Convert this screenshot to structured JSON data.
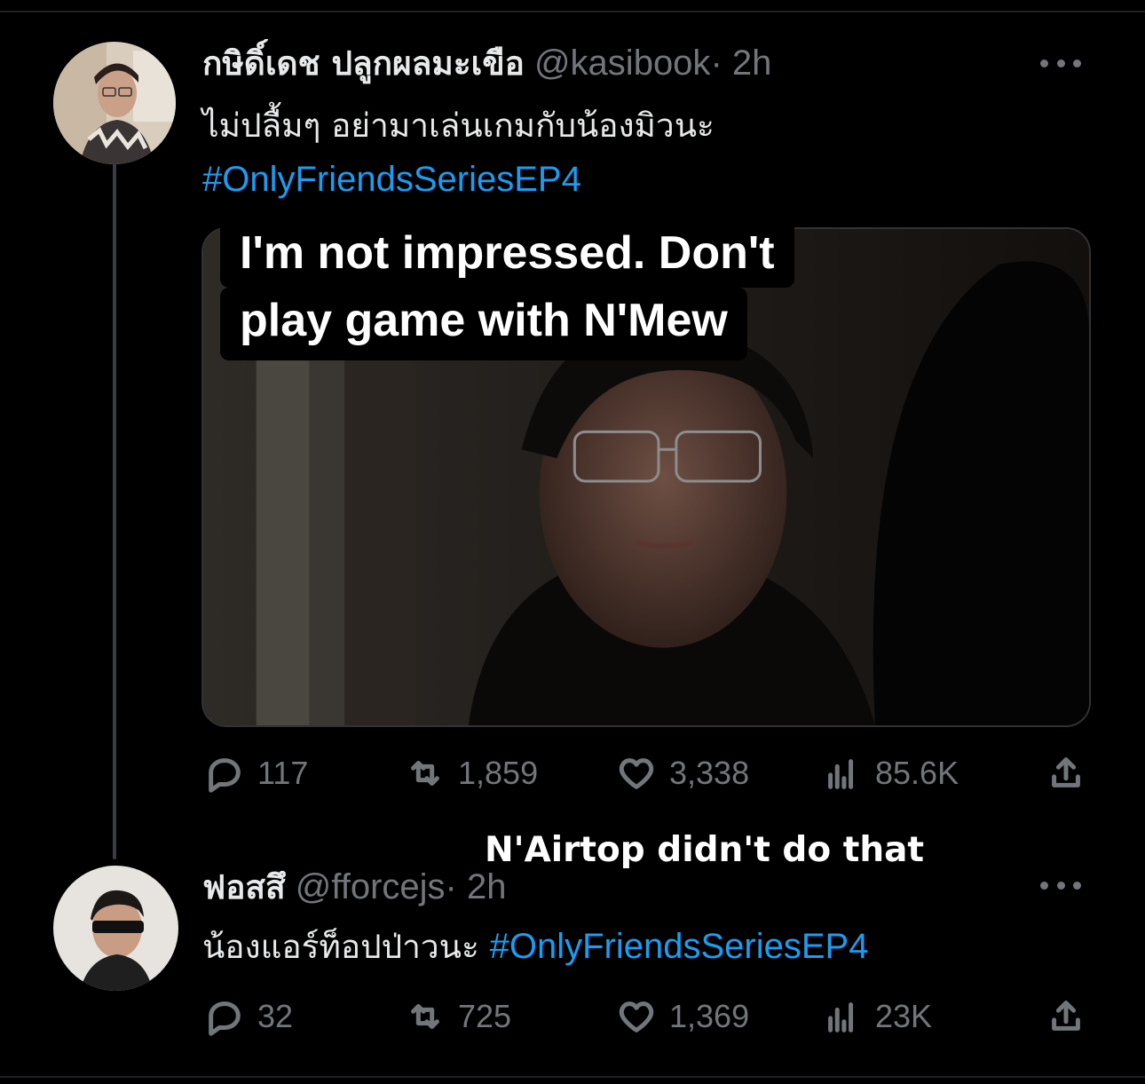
{
  "tweet1": {
    "display_name": "กษิดิ์เดช ปลูกผลมะเขือ",
    "handle": "@kasibook",
    "time": "· 2h",
    "text": "ไม่ปลื้มๆ อย่ามาเล่นเกมกับน้องมิวนะ",
    "hashtag": "#OnlyFriendsSeriesEP4",
    "caption_line1": "I'm not impressed. Don't",
    "caption_line2": "play game with N'Mew",
    "replies": "117",
    "retweets": "1,859",
    "likes": "3,338",
    "views": "85.6K"
  },
  "overlay_caption": "N'Airtop didn't do that",
  "tweet2": {
    "display_name": "ฟอสสึ",
    "handle": "@fforcejs",
    "time": "· 2h",
    "text": "น้องแอร์ท็อปป่าวนะ",
    "hashtag": "#OnlyFriendsSeriesEP4",
    "replies": "32",
    "retweets": "725",
    "likes": "1,369",
    "views": "23K"
  },
  "icons": {
    "reply": "reply-icon",
    "retweet": "retweet-icon",
    "like": "heart-icon",
    "views": "views-icon",
    "share": "share-icon",
    "more": "more-icon"
  },
  "colors": {
    "background": "#000000",
    "text": "#e7e9ea",
    "muted": "#71767b",
    "link": "#1d9bf0"
  }
}
